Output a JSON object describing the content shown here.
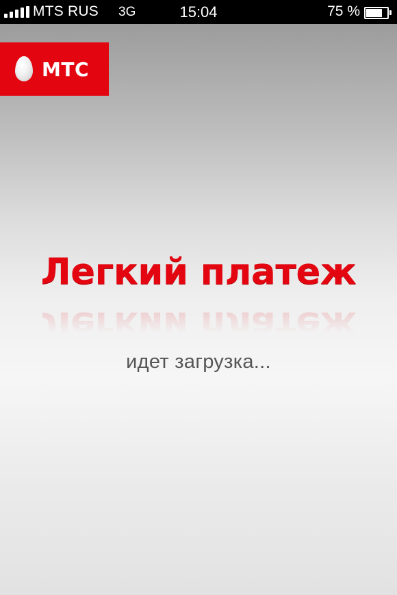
{
  "status_bar": {
    "carrier": "MTS RUS",
    "network": "3G",
    "time": "15:04",
    "battery_percent_text": "75 %",
    "battery_level": 0.75,
    "signal_bars": 5,
    "signal-icon": "signal-bars-icon",
    "battery-icon": "battery-icon"
  },
  "logo": {
    "text": "МТС",
    "icon": "mts-egg-icon",
    "background_color": "#e30611"
  },
  "splash": {
    "title": "Легкий платеж",
    "title_color": "#e30611",
    "loading_text": "идет загрузка..."
  }
}
